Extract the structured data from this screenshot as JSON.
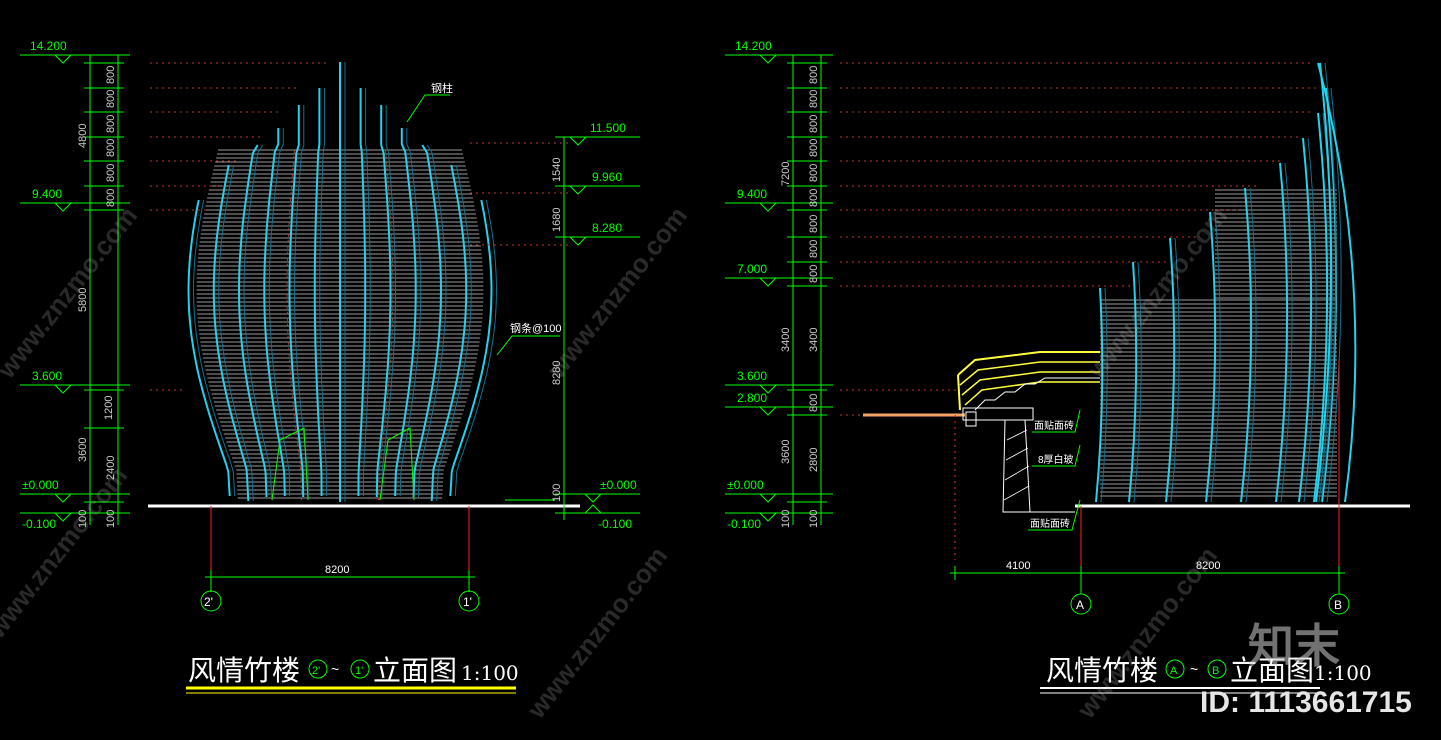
{
  "left": {
    "title_text": "风情竹楼",
    "title_axis_from": "2'",
    "title_tilde": "~",
    "title_axis_to": "1'",
    "title_suffix": "立面图",
    "scale": "1:100",
    "elev_labels": [
      "14.200",
      "9.400",
      "3.600",
      "±0.000",
      "-0.100"
    ],
    "right_elev_labels": [
      "11.500",
      "9.960",
      "8.280",
      "±0.000",
      "-0.100"
    ],
    "dims_outer": [
      "4800",
      "5800",
      "1200",
      "3600",
      "100"
    ],
    "dims_inner": [
      "800",
      "800",
      "800",
      "800",
      "800",
      "800",
      "2400",
      "100"
    ],
    "dims_right": [
      "1540",
      "1680",
      "8280",
      "100"
    ],
    "callout_top": "钢柱",
    "callout_side": "钢条@100",
    "width_dim": "8200",
    "axis_left": "2'",
    "axis_right": "1'"
  },
  "right": {
    "title_text": "风情竹楼",
    "title_axis_from": "A",
    "title_tilde": "~",
    "title_axis_to": "B",
    "title_suffix": "立面图",
    "scale": "1:100",
    "elev_labels": [
      "14.200",
      "9.400",
      "7.000",
      "3.600",
      "2.800",
      "±0.000",
      "-0.100"
    ],
    "dims_outer": [
      "7200",
      "3400",
      "3600",
      "100"
    ],
    "dims_inner": [
      "800",
      "800",
      "800",
      "800",
      "800",
      "800",
      "800",
      "800",
      "800",
      "3400",
      "800",
      "2800",
      "100"
    ],
    "callouts": [
      "面贴面砖",
      "8厚白玻",
      "面贴面砖"
    ],
    "width_dim_left": "4100",
    "width_dim_right": "8200",
    "axis_left": "A",
    "axis_right": "B"
  },
  "watermark": {
    "logo": "知末",
    "id_text": "ID: 1113661715",
    "diag_text": "www.znzmo.com"
  },
  "colors": {
    "background": "#000000",
    "dim_green": "#00ff00",
    "bamboo_cyan": "#22d3ee",
    "slat_grey": "#9a9a9a",
    "ground_white": "#ffffff",
    "axis_red": "#ff2020",
    "title_yellow": "#ffff00",
    "stair_yellow": "#ffff40",
    "deck_orange": "#f4a460",
    "inner_red_dashed": "#c0392b"
  }
}
